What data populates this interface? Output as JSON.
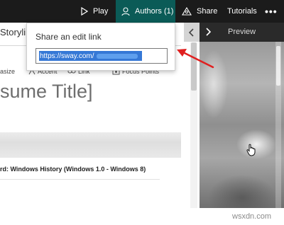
{
  "toolbar": {
    "play_label": "Play",
    "authors_label": "Authors (1)",
    "share_label": "Share",
    "tutorials_label": "Tutorials",
    "more_label": "•••",
    "authors_active_color": "#0b5b57"
  },
  "editor": {
    "storyline_tab": "Storylin",
    "format_items": [
      "asize",
      "Accent",
      "Link",
      "Focus Points"
    ],
    "title_text": "sume Title]",
    "card_text": "rd: Windows History (Windows 1.0 - Windows 8)"
  },
  "popup": {
    "title": "Share an edit link",
    "link_visible": "https://sway.com/",
    "selection_color": "#3578d6"
  },
  "preview": {
    "label": "Preview",
    "nav_left_icon": "chevron-left-icon",
    "nav_right_icon": "chevron-right-icon"
  },
  "annotation": {
    "arrow_color": "#e02020"
  },
  "watermark": "wsxdn.com"
}
